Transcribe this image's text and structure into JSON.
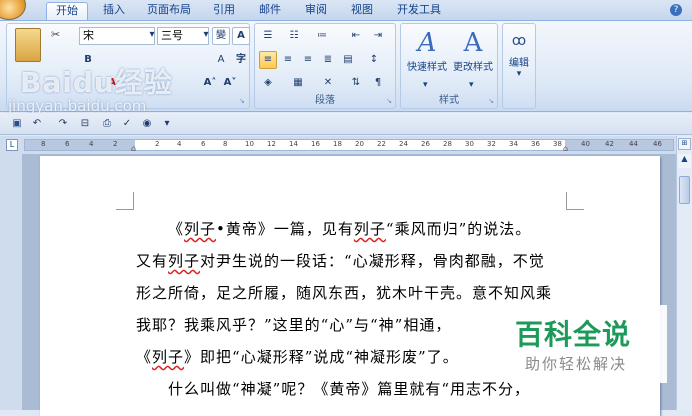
{
  "tabs": [
    "开始",
    "插入",
    "页面布局",
    "引用",
    "邮件",
    "审阅",
    "视图",
    "开发工具"
  ],
  "active_tab": "开始",
  "font": {
    "name": "宋",
    "size": "三号"
  },
  "groups": {
    "font_partial": "字体",
    "paragraph": "段落",
    "styles": "样式"
  },
  "styles": {
    "quick": "快速样式",
    "change": "更改样式"
  },
  "edit_label": "编辑",
  "watermark": {
    "brand": "Baidu经验",
    "url": "jingyan.baidu.com"
  },
  "ruler_ticks": [
    "8",
    "6",
    "4",
    "2",
    "",
    "2",
    "4",
    "6",
    "8",
    "10",
    "12",
    "14",
    "16",
    "18",
    "20",
    "22",
    "24",
    "26",
    "28",
    "30",
    "32",
    "34",
    "36",
    "38",
    "40",
    "42",
    "44",
    "46",
    "48"
  ],
  "doc_lines": [
    [
      "《",
      {
        "w": "列子"
      },
      "•黄帝》一篇，见有",
      {
        "w": "列子"
      },
      "“乘风而归”的说法。"
    ],
    [
      "又有",
      {
        "w": "列子"
      },
      "对尹生说的一段话：“心凝形释，骨肉都融，不觉"
    ],
    [
      "形之所倚，足之所履，随风东西，犹木叶干壳。意不知风乘"
    ],
    [
      "我耶？我乘风乎？”这里的“心”与“神”相通，"
    ],
    [
      "《",
      {
        "w": "列子"
      },
      "》即把“心凝形释”说成“神凝形废”了。"
    ],
    [
      "什么叫做“神凝”呢？《黄帝》篇里就有“用志不分，"
    ]
  ],
  "badge": {
    "title": "百科全说",
    "subtitle": "助你轻松解决"
  },
  "colors": {
    "badge_green": "#1d9a5a",
    "ribbon_blue": "#15428b"
  }
}
